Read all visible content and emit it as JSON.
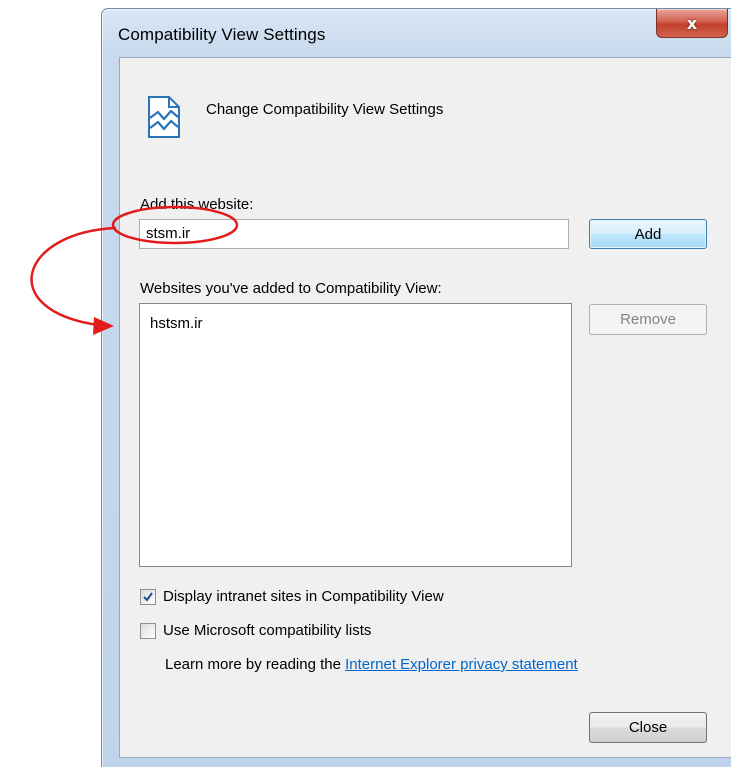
{
  "window": {
    "title": "Compatibility View Settings",
    "close_glyph": "x",
    "close_icon": "close-icon"
  },
  "header": {
    "icon": "broken-page-icon",
    "text": "Change Compatibility View Settings"
  },
  "add_site": {
    "label": "Add this website:",
    "value": "stsm.ir",
    "button_label": "Add"
  },
  "site_list": {
    "label": "Websites you've added to Compatibility View:",
    "items": [
      "hstsm.ir"
    ],
    "remove_label": "Remove"
  },
  "options": [
    {
      "label": "Display intranet sites in Compatibility View",
      "checked": true
    },
    {
      "label": "Use Microsoft compatibility lists",
      "checked": false
    }
  ],
  "learn_more": {
    "prefix": "Learn more by reading the ",
    "link_text": "Internet Explorer privacy statement"
  },
  "footer": {
    "close_label": "Close"
  },
  "annotation": {
    "color": "#e31b1b"
  }
}
